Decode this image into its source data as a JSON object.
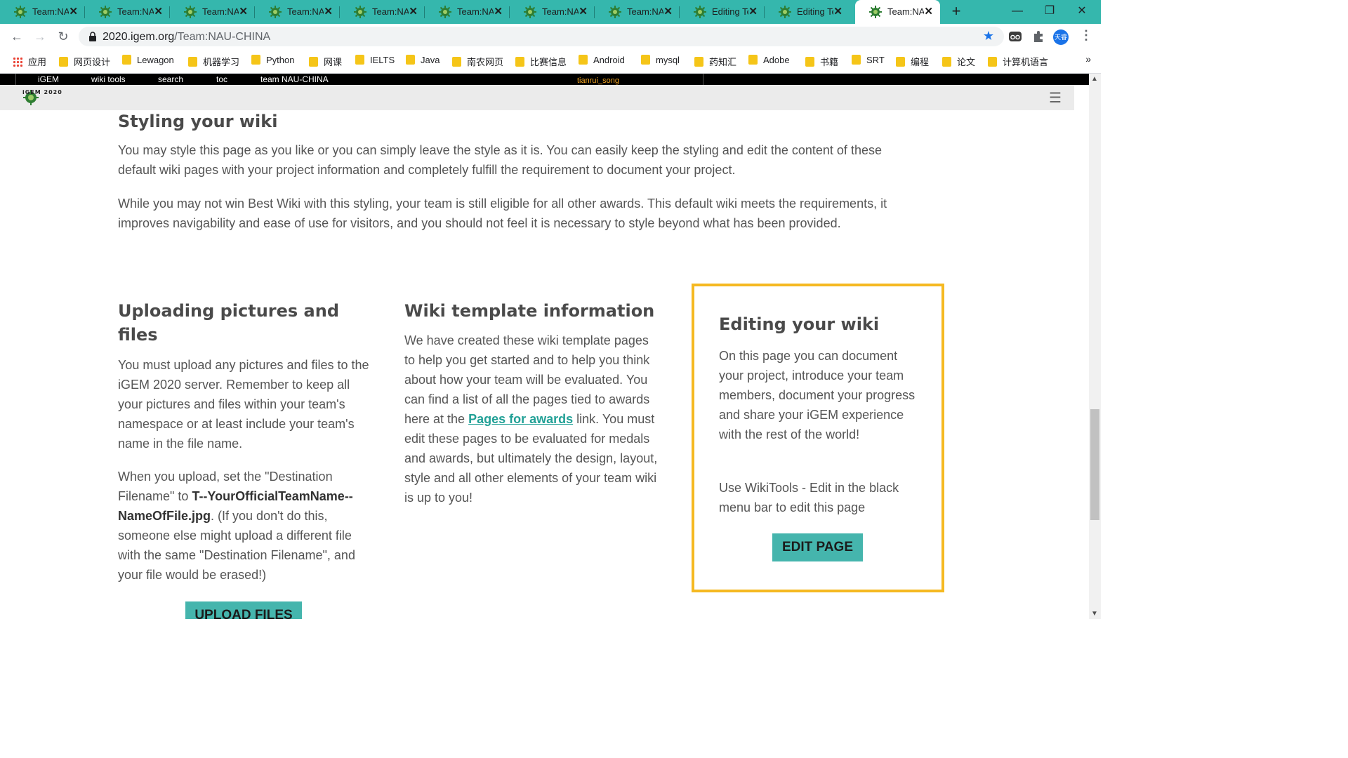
{
  "browser": {
    "tabs": [
      {
        "title": "Team:NAU-CHINA",
        "active": false
      },
      {
        "title": "Team:NAU-CHINA",
        "active": false
      },
      {
        "title": "Team:NAU-CHINA",
        "active": false
      },
      {
        "title": "Team:NAU-CHINA",
        "active": false
      },
      {
        "title": "Team:NAU-CHINA",
        "active": false
      },
      {
        "title": "Team:NAU-CHINA",
        "active": false
      },
      {
        "title": "Team:NAU-CHINA",
        "active": false
      },
      {
        "title": "Team:NAU-CHINA",
        "active": false
      },
      {
        "title": "Editing Team:NAU-CHINA",
        "active": false
      },
      {
        "title": "Editing Team:NAU-CHINA",
        "active": false
      },
      {
        "title": "Team:NAU-CHINA",
        "active": true
      }
    ],
    "url_domain": "2020.igem.org",
    "url_path": "/Team:NAU-CHINA",
    "profile_label": "天睿",
    "accent_color": "#35b7ad"
  },
  "bookmarks": [
    {
      "label": "应用",
      "icon": "apps-grid-icon"
    },
    {
      "label": "网页设计"
    },
    {
      "label": "Lewagon"
    },
    {
      "label": "机器学习"
    },
    {
      "label": "Python"
    },
    {
      "label": "网课"
    },
    {
      "label": "IELTS"
    },
    {
      "label": "Java"
    },
    {
      "label": "南农网页"
    },
    {
      "label": "比赛信息"
    },
    {
      "label": "Android"
    },
    {
      "label": "mysql"
    },
    {
      "label": "药知汇"
    },
    {
      "label": "Adobe"
    },
    {
      "label": "书籍"
    },
    {
      "label": "SRT"
    },
    {
      "label": "编程"
    },
    {
      "label": "论文"
    },
    {
      "label": "计算机语言"
    }
  ],
  "igem_bar": {
    "items": [
      "iGEM",
      "wiki tools",
      "search",
      "toc",
      "team NAU-CHINA"
    ],
    "user": "tianrui_song"
  },
  "topnav": {
    "logo_text": "iGEM 2020"
  },
  "styling": {
    "heading": "Styling your wiki",
    "p1": "You may style this page as you like or you can simply leave the style as it is. You can easily keep the styling and edit the content of these default wiki pages with your project information and completely fulfill the requirement to document your project.",
    "p2": "While you may not win Best Wiki with this styling, your team is still eligible for all other awards. This default wiki meets the requirements, it improves navigability and ease of use for visitors, and you should not feel it is necessary to style beyond what has been provided."
  },
  "uploading": {
    "heading": "Uploading pictures and files",
    "p1": "You must upload any pictures and files to the iGEM 2020 server. Remember to keep all your pictures and files within your team's namespace or at least include your team's name in the file name.",
    "p2_a": "When you upload, set the \"Destination Filename\" to ",
    "p2_bold": "T--YourOfficialTeamName--NameOfFile.jpg",
    "p2_b": ". (If you don't do this, someone else might upload a different file with the same \"Destination Filename\", and your file would be erased!)",
    "button": "UPLOAD FILES"
  },
  "template": {
    "heading": "Wiki template information",
    "p_a": "We have created these wiki template pages to help you get started and to help you think about how your team will be evaluated. You can find a list of all the pages tied to awards here at the ",
    "link": "Pages for awards",
    "p_b": " link. You must edit these pages to be evaluated for medals and awards, but ultimately the design, layout, style and all other elements of your team wiki is up to you!"
  },
  "editing": {
    "heading": "Editing your wiki",
    "p1": "On this page you can document your project, introduce your team members, document your progress and share your iGEM experience with the rest of the world!",
    "p2": "Use WikiTools - Edit in the black menu bar to edit this page",
    "button": "EDIT PAGE",
    "border_color": "#f5b921",
    "button_color": "#45b5ad"
  }
}
